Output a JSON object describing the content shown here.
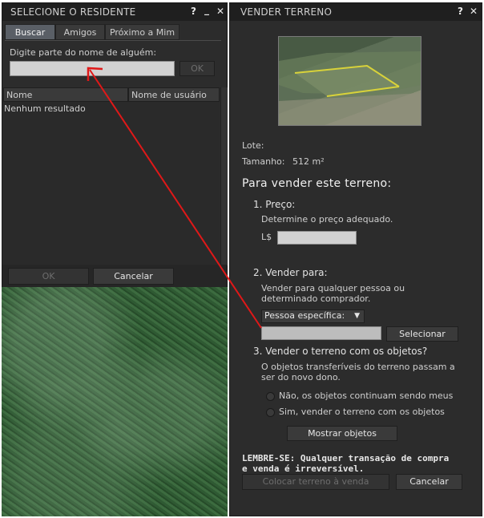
{
  "resident_window": {
    "title": "SELECIONE O RESIDENTE",
    "controls": {
      "help": "?",
      "minimize": "_",
      "close": "✕"
    },
    "tabs": [
      {
        "label": "Buscar",
        "active": true
      },
      {
        "label": "Amigos",
        "active": false
      },
      {
        "label": "Próximo a Mim",
        "active": false
      }
    ],
    "search_prompt": "Digite parte do nome de alguém:",
    "search_value": "",
    "search_ok": "OK",
    "columns": [
      "Nome",
      "Nome de usuário"
    ],
    "empty_text": "Nenhum resultado",
    "ok_button": "OK",
    "cancel_button": "Cancelar"
  },
  "sell_window": {
    "title": "VENDER TERRENO",
    "controls": {
      "help": "?",
      "close": "✕"
    },
    "lote_label": "Lote:",
    "tamanho_label": "Tamanho:",
    "tamanho_value": "512 m²",
    "heading": "Para vender este terreno:",
    "step1": {
      "title": "1. Preço:",
      "desc": "Determine o preço adequado.",
      "currency": "L$",
      "price_value": ""
    },
    "step2": {
      "title": "2. Vender para:",
      "desc_line1": "Vender para qualquer pessoa ou",
      "desc_line2": "determinado comprador.",
      "combo_value": "Pessoa específica:",
      "buyer_value": "",
      "select_button": "Selecionar"
    },
    "step3": {
      "title": "3. Vender o terreno com os objetos?",
      "desc_line1": "O objetos transferíveis do terreno passam a",
      "desc_line2": "ser do novo dono.",
      "option_no": "Não, os objetos continuam sendo meus",
      "option_yes": "Sim, vender o terreno com os objetos",
      "show_objects_button": "Mostrar objetos"
    },
    "warning_line1": "LEMBRE-SE: Qualquer transação de compra",
    "warning_line2": "e venda é irreversível.",
    "sell_button": "Colocar terreno à venda",
    "cancel_button": "Cancelar"
  },
  "colors": {
    "panel": "#2c2c2c",
    "titlebar": "#1f1f1f",
    "active_tab": "#5a5f66",
    "annotation_arrow": "#e01818",
    "plot_line": "#d8d23a"
  }
}
